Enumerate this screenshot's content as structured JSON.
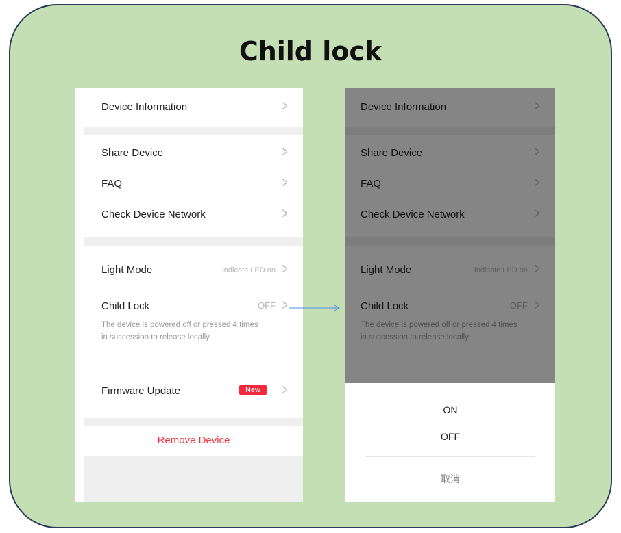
{
  "title": "Child lock",
  "settings": {
    "device_information": "Device Information",
    "share_device": "Share Device",
    "faq": "FAQ",
    "check_device_network": "Check Device Network",
    "light_mode": "Light Mode",
    "light_mode_value": "Indicate LED on",
    "child_lock": "Child Lock",
    "child_lock_value": "OFF",
    "child_lock_desc": "The device is powered off or pressed 4 times in succession to release locally",
    "firmware_update": "Firmware Update",
    "firmware_badge": "New",
    "remove_device": "Remove Device",
    "chevron": ">"
  },
  "sheet": {
    "on": "ON",
    "off": "OFF",
    "cancel": "取消"
  },
  "colors": {
    "card_bg": "#c5dfb4",
    "card_border": "#2b3a5a",
    "accent_red": "#f0293d",
    "arrow": "#4a90e2"
  }
}
